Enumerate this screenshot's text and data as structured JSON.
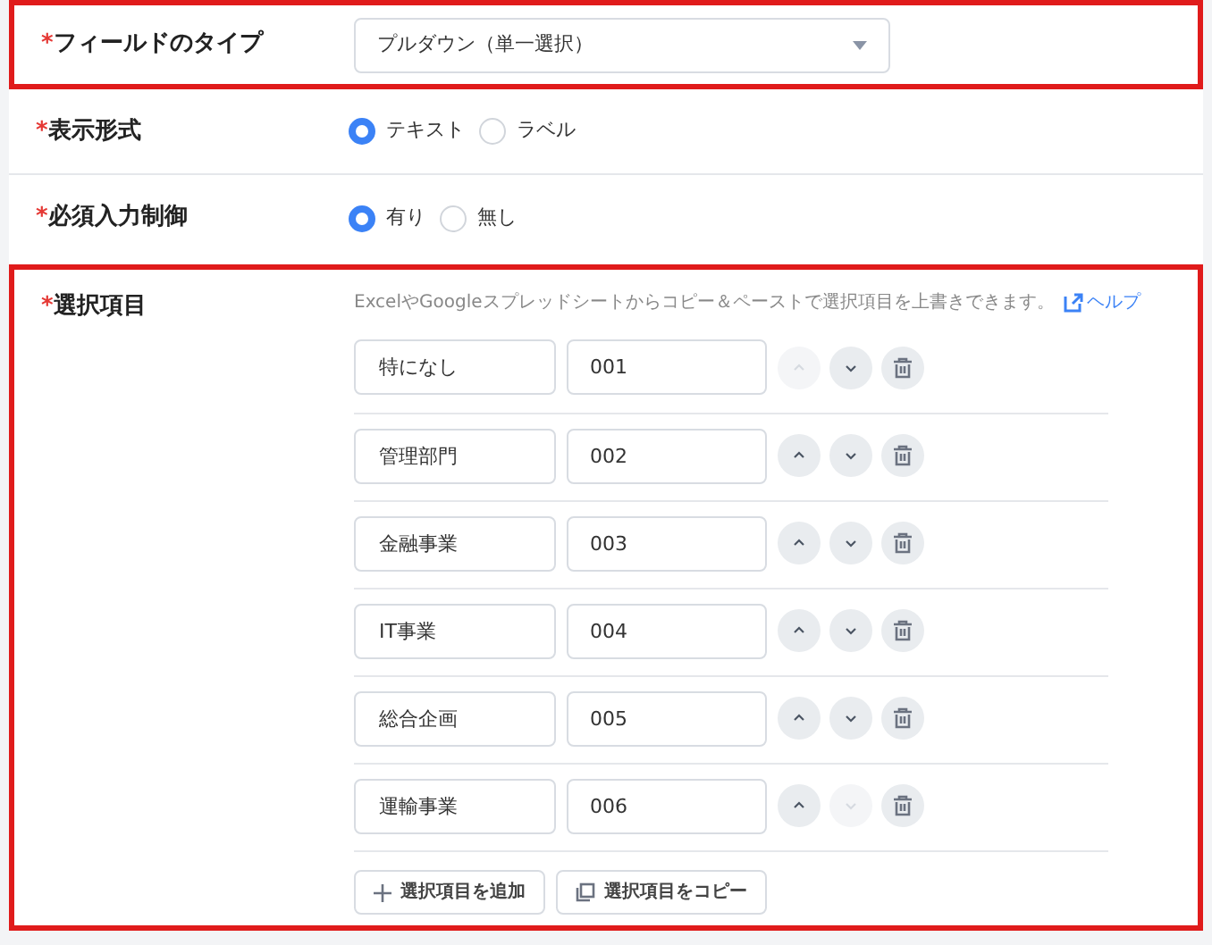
{
  "field_type": {
    "label": "フィールドのタイプ",
    "required_mark": "*",
    "value": "プルダウン（単一選択）",
    "highlighted": true
  },
  "display_format": {
    "label": "表示形式",
    "required_mark": "*",
    "options": [
      {
        "label": "テキスト",
        "selected": true
      },
      {
        "label": "ラベル",
        "selected": false
      }
    ]
  },
  "required_input": {
    "label": "必須入力制御",
    "required_mark": "*",
    "options": [
      {
        "label": "有り",
        "selected": true
      },
      {
        "label": "無し",
        "selected": false
      }
    ]
  },
  "choices": {
    "label": "選択項目",
    "required_mark": "*",
    "highlighted": true,
    "hint": "ExcelやGoogleスプレッドシートからコピー＆ペーストで選択項目を上書きできます。",
    "help_link": "ヘルプ",
    "items": [
      {
        "name": "特になし",
        "code": "001",
        "up_disabled": true,
        "down_disabled": false
      },
      {
        "name": "管理部門",
        "code": "002",
        "up_disabled": false,
        "down_disabled": false
      },
      {
        "name": "金融事業",
        "code": "003",
        "up_disabled": false,
        "down_disabled": false
      },
      {
        "name": "IT事業",
        "code": "004",
        "up_disabled": false,
        "down_disabled": false
      },
      {
        "name": "総合企画",
        "code": "005",
        "up_disabled": false,
        "down_disabled": false
      },
      {
        "name": "運輸事業",
        "code": "006",
        "up_disabled": false,
        "down_disabled": true
      }
    ],
    "buttons": [
      {
        "kind": "add",
        "label": "選択項目を追加"
      },
      {
        "kind": "copy",
        "label": "選択項目をコピー"
      }
    ]
  }
}
